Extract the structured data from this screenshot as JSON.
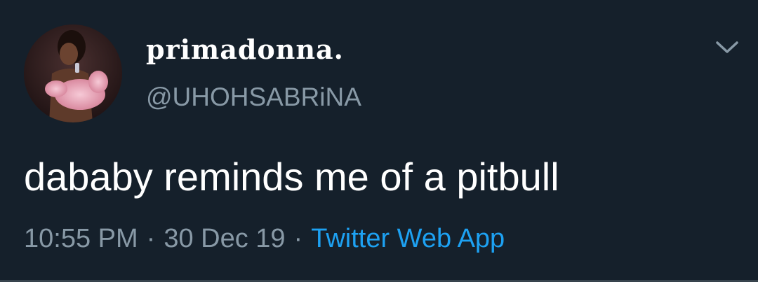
{
  "user": {
    "display_name": "primadonna.",
    "handle": "@UHOHSABRiNA",
    "avatar_icon": "profile-photo"
  },
  "tweet": {
    "text": "dababy reminds me of a pitbull",
    "time": "10:55 PM",
    "date": "30 Dec 19",
    "source": "Twitter Web App",
    "separator": "·"
  },
  "menu_icon": "chevron-down-icon",
  "colors": {
    "background": "#15202b",
    "text": "#ffffff",
    "muted": "#8899a6",
    "link": "#1da1f2",
    "divider": "#38444d"
  }
}
